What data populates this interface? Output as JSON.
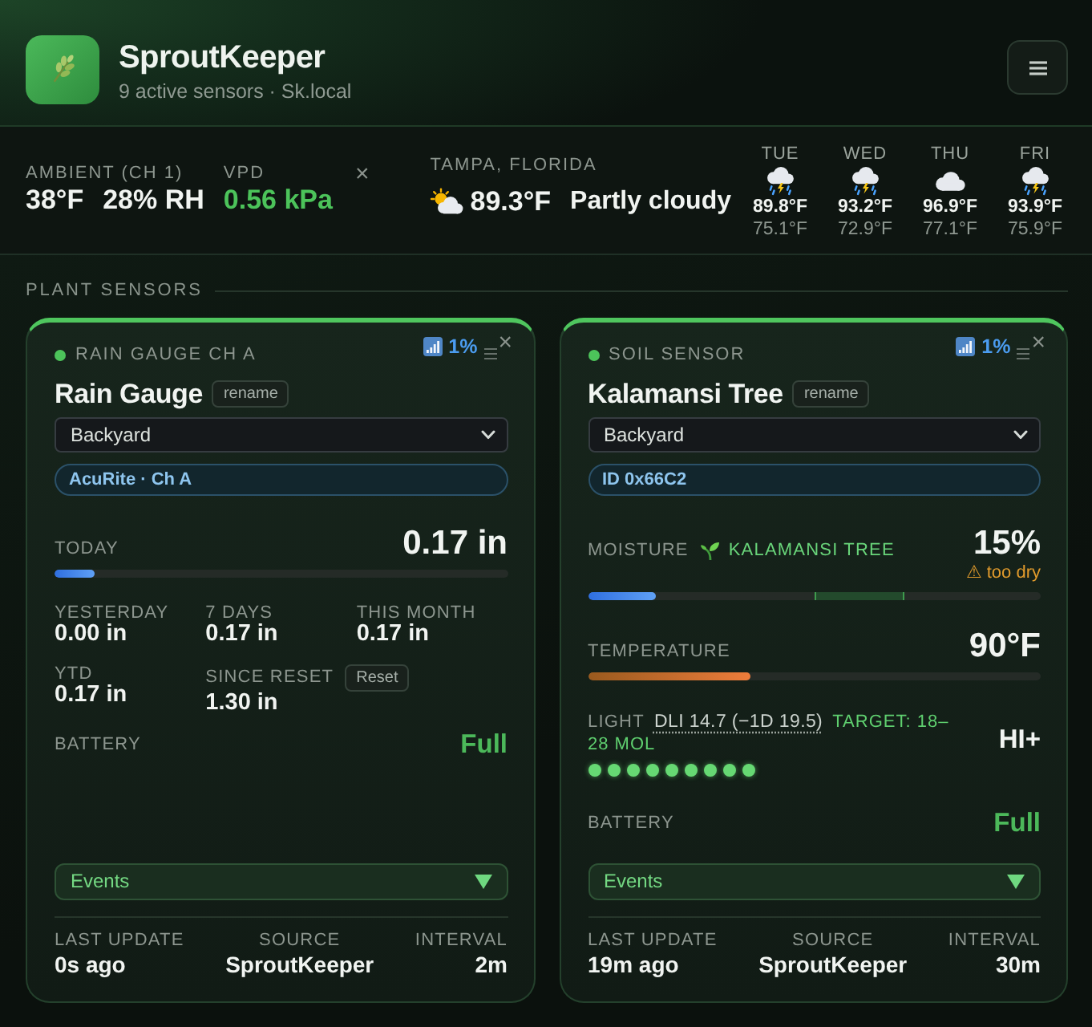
{
  "header": {
    "title": "SproutKeeper",
    "subtitle": "9 active sensors · Sk.local"
  },
  "conditions": {
    "ambient": {
      "label": "AMBIENT (CH 1)",
      "temperature": "38°F",
      "humidity": "28% RH"
    },
    "vpd": {
      "label": "VPD",
      "value": "0.56 kPa"
    },
    "dismiss": "×",
    "weather": {
      "location": "TAMPA, FLORIDA",
      "temperature": "89.3°F",
      "condition": "Partly cloudy"
    },
    "forecast": [
      {
        "day": "TUE",
        "kind": "storm",
        "high": "89.8°F",
        "low": "75.1°F"
      },
      {
        "day": "WED",
        "kind": "storm",
        "high": "93.2°F",
        "low": "72.9°F"
      },
      {
        "day": "THU",
        "kind": "cloud",
        "high": "96.9°F",
        "low": "77.1°F"
      },
      {
        "day": "FRI",
        "kind": "storm",
        "high": "93.9°F",
        "low": "75.9°F"
      }
    ]
  },
  "section_title": "PLANT SENSORS",
  "cards": [
    {
      "kind": "rain",
      "type_label": "RAIN GAUGE CH A",
      "online": true,
      "signal": "1%",
      "close": "×",
      "name": "Rain Gauge",
      "rename": "rename",
      "location": "Backyard",
      "tag": "AcuRite · Ch A",
      "today": {
        "label": "TODAY",
        "value": "0.17 in",
        "level": 0.09
      },
      "stats": [
        {
          "label": "YESTERDAY",
          "value": "0.00 in"
        },
        {
          "label": "7 DAYS",
          "value": "0.17 in"
        },
        {
          "label": "THIS MONTH",
          "value": "0.17 in"
        },
        {
          "label": "YTD",
          "value": "0.17 in"
        },
        {
          "label": "SINCE RESET",
          "value": "1.30 in",
          "action": "Reset"
        }
      ],
      "battery": {
        "label": "BATTERY",
        "value": "Full"
      },
      "events": "Events",
      "footer": [
        {
          "label": "LAST UPDATE",
          "value": "0s ago"
        },
        {
          "label": "SOURCE",
          "value": "SproutKeeper"
        },
        {
          "label": "INTERVAL",
          "value": "2m"
        }
      ]
    },
    {
      "kind": "soil",
      "type_label": "SOIL SENSOR",
      "online": true,
      "signal": "1%",
      "close": "×",
      "name": "Kalamansi Tree",
      "rename": "rename",
      "location": "Backyard",
      "tag": "ID 0x66C2",
      "moisture": {
        "label": "MOISTURE",
        "plant": "KALAMANSI TREE",
        "value": "15%",
        "warning": "⚠ too dry",
        "level": 0.15
      },
      "temperature": {
        "label": "TEMPERATURE",
        "value": "90°F",
        "level": 0.36
      },
      "light": {
        "label": "LIGHT",
        "dli": "DLI 14.7 (−1D 19.5)",
        "target": "TARGET: 18–28 MOL",
        "value": "HI+",
        "stars": 9
      },
      "battery": {
        "label": "BATTERY",
        "value": "Full"
      },
      "events": "Events",
      "footer": [
        {
          "label": "LAST UPDATE",
          "value": "19m ago"
        },
        {
          "label": "SOURCE",
          "value": "SproutKeeper"
        },
        {
          "label": "INTERVAL",
          "value": "30m"
        }
      ]
    }
  ]
}
